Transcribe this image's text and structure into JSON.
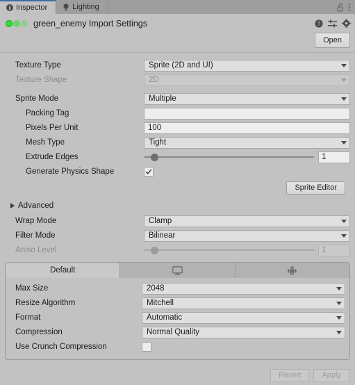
{
  "tabbar": {
    "tabs": [
      {
        "label": "Inspector",
        "icon": "info-icon",
        "active": true
      },
      {
        "label": "Lighting",
        "icon": "lightbulb-icon",
        "active": false
      }
    ],
    "lock_icon": "unlocked-padlock-icon",
    "menu_icon": "kebab-menu-icon"
  },
  "object_header": {
    "title": "green_enemy Import Settings",
    "preview_icon": "sprite-preview-icon",
    "help_icon": "help-icon",
    "preset_icon": "preset-icon",
    "settings_icon": "gear-icon",
    "open_button": "Open"
  },
  "texture": {
    "rows": [
      {
        "label": "Texture Type",
        "value": "Sprite (2D and UI)",
        "control": "dropdown",
        "disabled": false
      },
      {
        "label": "Texture Shape",
        "value": "2D",
        "control": "dropdown",
        "disabled": true
      },
      {
        "label": "Sprite Mode",
        "value": "Multiple",
        "control": "dropdown",
        "disabled": false
      }
    ]
  },
  "sprite": {
    "packing_tag_label": "Packing Tag",
    "packing_tag_value": "",
    "pixels_per_unit_label": "Pixels Per Unit",
    "pixels_per_unit_value": "100",
    "mesh_type_label": "Mesh Type",
    "mesh_type_value": "Tight",
    "extrude_edges_label": "Extrude Edges",
    "extrude_edges_value": "1",
    "extrude_edges_percent": 6,
    "generate_physics_shape_label": "Generate Physics Shape",
    "generate_physics_shape_checked": true,
    "sprite_editor_button": "Sprite Editor"
  },
  "advanced": {
    "label": "Advanced",
    "expanded": false
  },
  "filtering": {
    "wrap_mode_label": "Wrap Mode",
    "wrap_mode_value": "Clamp",
    "filter_mode_label": "Filter Mode",
    "filter_mode_value": "Bilinear",
    "aniso_level_label": "Aniso Level",
    "aniso_level_value": "1",
    "aniso_level_percent": 6
  },
  "platform": {
    "tabs": [
      {
        "label": "Default",
        "icon": "",
        "active": true
      },
      {
        "label": "",
        "icon": "monitor-icon",
        "active": false
      },
      {
        "label": "",
        "icon": "android-icon",
        "active": false
      }
    ],
    "rows": [
      {
        "label": "Max Size",
        "value": "2048",
        "control": "dropdown"
      },
      {
        "label": "Resize Algorithm",
        "value": "Mitchell",
        "control": "dropdown"
      },
      {
        "label": "Format",
        "value": "Automatic",
        "control": "dropdown"
      },
      {
        "label": "Compression",
        "value": "Normal Quality",
        "control": "dropdown"
      }
    ],
    "crunch_label": "Use Crunch Compression",
    "crunch_checked": false
  },
  "footer": {
    "revert_button": "Revert",
    "apply_button": "Apply"
  },
  "colors": {
    "window_bg": "#c2c2c2",
    "tabbar_bg": "#9e9e9e",
    "accent_tab": "#3c6ea5",
    "field_bg": "#dfdfdf",
    "sprite_green": "#2ee02e"
  }
}
